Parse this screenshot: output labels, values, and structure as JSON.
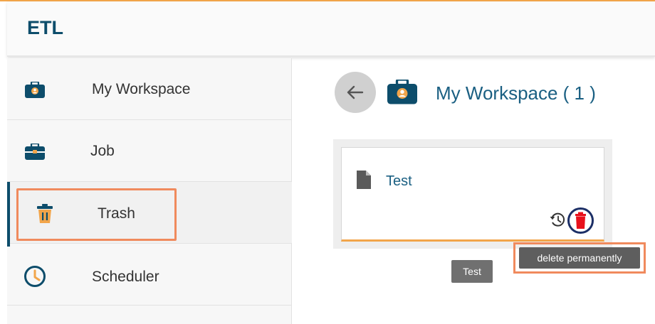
{
  "app": {
    "title": "ETL"
  },
  "colors": {
    "accent": "#f2a54a",
    "brand": "#0d4d6b",
    "link": "#1a5f82",
    "highlight": "#f08a5d",
    "delete": "#e8111c"
  },
  "sidebar": {
    "items": [
      {
        "label": "My Workspace",
        "icon": "briefcase-icon"
      },
      {
        "label": "Job",
        "icon": "briefcase-icon"
      },
      {
        "label": "Trash",
        "icon": "trash-icon",
        "active": true
      },
      {
        "label": "Scheduler",
        "icon": "clock-icon"
      }
    ]
  },
  "main": {
    "title": "My Workspace ( 1 )",
    "back_icon": "arrow-left-icon",
    "card": {
      "title": "Test",
      "icon": "file-icon",
      "restore_icon": "restore-icon",
      "delete_icon": "delete-icon"
    }
  },
  "tooltips": {
    "delete": "delete permanently",
    "card": "Test"
  }
}
